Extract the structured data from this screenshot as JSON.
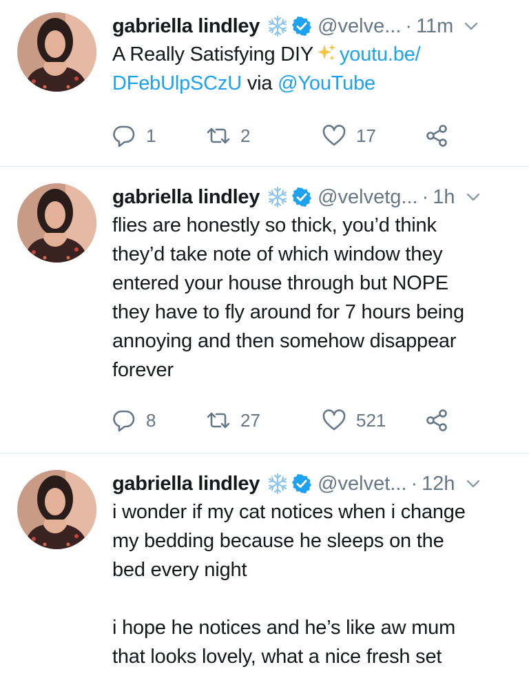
{
  "tweets": [
    {
      "name": "gabriella lindley",
      "handle": "@velve...",
      "separator": "·",
      "time": "11m",
      "text_plain_1": "A Really Satisfying DIY",
      "link_1": "youtu.be/",
      "link_2": "DFebUlpSCzU",
      "text_plain_2": "via",
      "mention": "@YouTube",
      "replies": "1",
      "retweets": "2",
      "likes": "17"
    },
    {
      "name": "gabriella lindley",
      "handle": "@velvetg...",
      "separator": "·",
      "time": "1h",
      "lines": [
        "flies are honestly so thick, you’d think",
        "they’d take note of which window they",
        "entered your house through but NOPE",
        "they have to fly around for 7 hours being",
        "annoying and then somehow disappear",
        "forever"
      ],
      "replies": "8",
      "retweets": "27",
      "likes": "521"
    },
    {
      "name": "gabriella lindley",
      "handle": "@velvet...",
      "separator": "·",
      "time": "12h",
      "lines": [
        "i wonder if my cat notices when i change",
        "my bedding because he sleeps on the",
        "bed every night"
      ],
      "lines_2": [
        "i hope he notices and he’s like aw mum",
        "that looks lovely, what a nice fresh set"
      ]
    }
  ],
  "colors": {
    "accent": "#1da1f2",
    "muted": "#657786",
    "text": "#14171a",
    "divider": "#e1e8ed"
  },
  "icons": [
    "snowflake-icon",
    "verified-badge-icon",
    "chevron-down-icon",
    "reply-icon",
    "retweet-icon",
    "like-icon",
    "share-icon",
    "sparkles-icon"
  ]
}
